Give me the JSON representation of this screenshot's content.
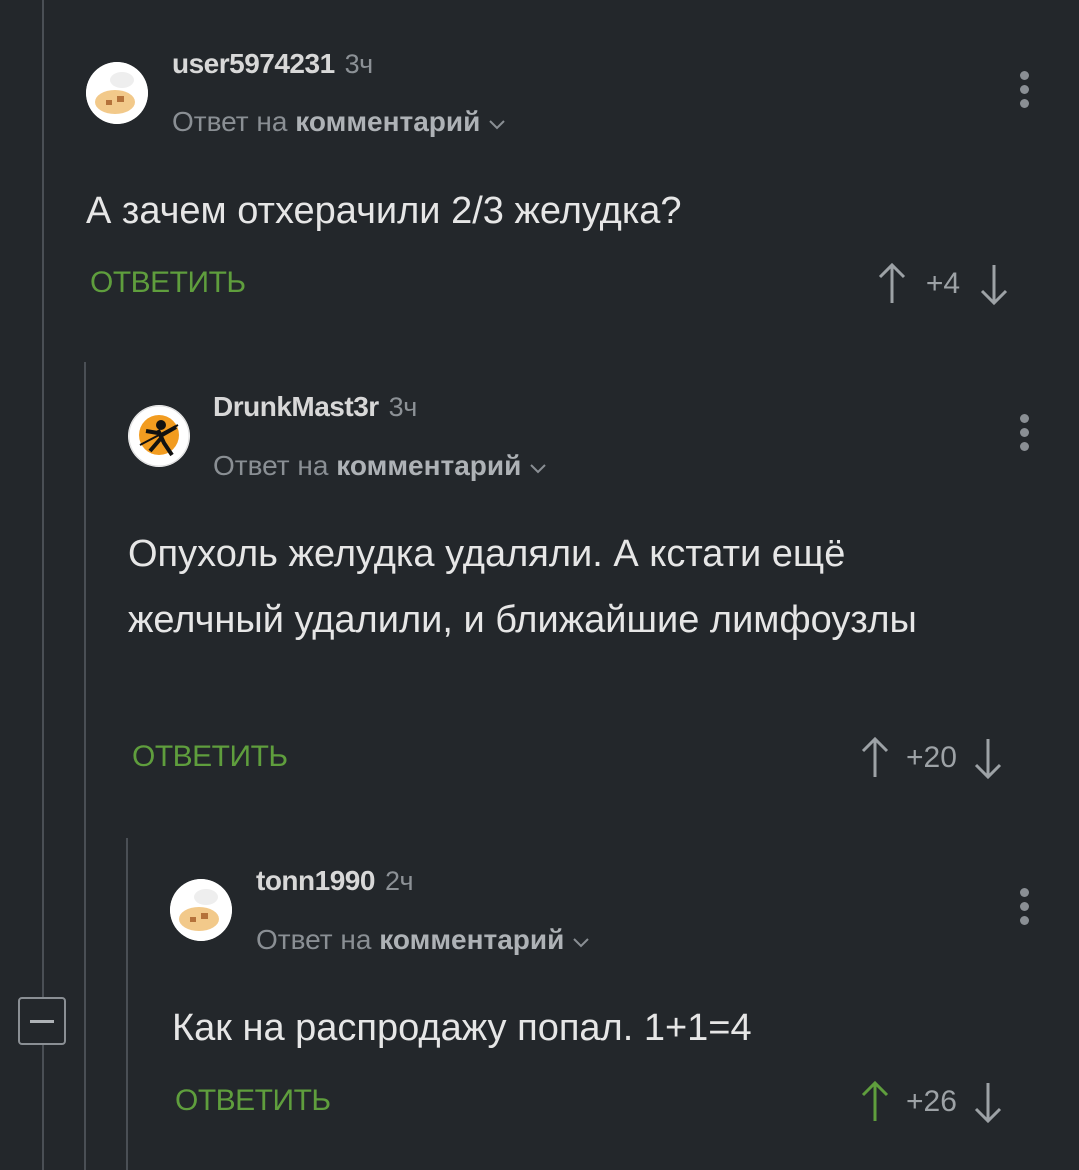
{
  "comments": [
    {
      "author": "user5974231",
      "time": "3ч",
      "reply_prefix": "Ответ на",
      "reply_link": "комментарий",
      "text": "А зачем отхерачили 2/3 желудка?",
      "reply_label": "ОТВЕТИТЬ",
      "rating": "+4",
      "avatar": "default-chef-icon"
    },
    {
      "author": "DrunkMast3r",
      "time": "3ч",
      "reply_prefix": "Ответ на",
      "reply_link": "комментарий",
      "text": "Опухоль желудка удаляли. А кстати ещё желчный удалили, и ближайшие лимфоузлы",
      "reply_label": "ОТВЕТИТЬ",
      "rating": "+20",
      "avatar": "ninja-icon"
    },
    {
      "author": "tonn1990",
      "time": "2ч",
      "reply_prefix": "Ответ на",
      "reply_link": "комментарий",
      "text": "Как на распродажу попал. 1+1=4",
      "reply_label": "ОТВЕТИТЬ",
      "rating": "+26",
      "avatar": "default-chef-icon",
      "upvoted": true
    }
  ],
  "colors": {
    "background": "#23272b",
    "accent_green": "#5f9e3d",
    "muted": "#8a8f94"
  }
}
